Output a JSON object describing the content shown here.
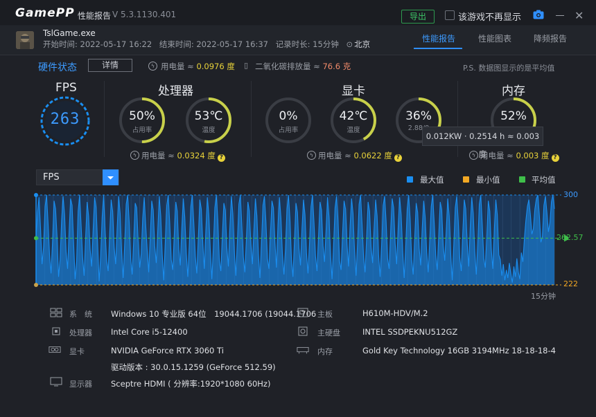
{
  "window": {
    "brand": "GamePP",
    "title": "性能报告",
    "version": "V 5.3.1130.401",
    "export_label": "导出",
    "no_show_label": "该游戏不再显示"
  },
  "session": {
    "process": "TslGame.exe",
    "start": "开始时间: 2022-05-17 16:22",
    "end": "结束时间: 2022-05-17 16:37",
    "duration": "记录时长: 15分钟",
    "location": "北京"
  },
  "tabs": [
    "性能报告",
    "性能图表",
    "降频报告"
  ],
  "hardware": {
    "title": "硬件状态",
    "detail_label": "详情",
    "power_label": "用电量 ≈",
    "power_value": "0.0976 度",
    "co2_label": "二氧化碳排放量 ≈",
    "co2_value": "76.6 克",
    "note": "P.S. 数据图显示的是平均值"
  },
  "fps": {
    "title": "FPS",
    "value": "263"
  },
  "cpu": {
    "title": "处理器",
    "usage": "50%",
    "usage_label": "占用率",
    "usage_frac": 0.5,
    "temp": "53℃",
    "temp_label": "温度",
    "temp_frac": 0.53,
    "power_label": "用电量 ≈",
    "power_value": "0.0324 度"
  },
  "gpu": {
    "title": "显卡",
    "usage": "0%",
    "usage_label": "占用率",
    "usage_frac": 0.0,
    "temp": "42℃",
    "temp_label": "温度",
    "temp_frac": 0.42,
    "vram": "36%",
    "vram_sub": "2.88/8",
    "vram_frac": 0.36,
    "power_label": "用电量 ≈",
    "power_value": "0.0622 度"
  },
  "mem": {
    "title": "内存",
    "usage": "52%",
    "usage_frac": 0.52,
    "power_label": "用电量 ≈",
    "power_value": "0.003 度"
  },
  "tooltip": "0.012KW · 0.2514 h ≈ 0.003度",
  "chart_select": "FPS",
  "legend": {
    "max": "最大值",
    "min": "最小值",
    "avg": "平均值"
  },
  "colors": {
    "accent": "#2f8fff",
    "max": "#1a8ef0",
    "min": "#f2a824",
    "avg": "#3fbf4a",
    "yellow": "#e8d23a"
  },
  "chart_data": {
    "type": "area",
    "series": [
      {
        "name": "FPS"
      }
    ],
    "y_ticks": [
      "300",
      "262.57",
      "222"
    ],
    "ylim": [
      222,
      300
    ],
    "avg": 262.57,
    "x_label": "15分钟",
    "values": [
      262,
      285,
      298,
      271,
      240,
      255,
      290,
      300,
      276,
      248,
      232,
      260,
      295,
      288,
      264,
      229,
      244,
      278,
      299,
      283,
      251,
      236,
      268,
      297,
      291,
      259,
      227,
      242,
      286,
      300,
      274,
      246,
      230,
      263,
      294,
      282,
      253,
      238,
      270,
      298,
      289,
      257,
      225,
      247,
      281,
      300,
      269,
      243,
      234,
      266,
      296,
      286,
      255,
      240,
      272,
      299,
      284,
      250,
      228,
      258,
      292,
      300,
      277,
      245,
      231,
      261,
      293,
      289,
      260,
      237,
      249,
      280,
      298,
      274,
      252,
      233,
      264,
      295,
      287,
      256,
      241,
      268,
      299,
      282,
      248,
      226,
      259,
      291,
      300,
      275,
      244,
      235,
      266,
      294,
      286,
      253,
      239,
      271,
      297,
      281,
      250,
      229,
      257,
      290,
      300,
      276,
      247,
      232,
      263,
      296,
      288,
      258,
      236,
      269,
      298,
      283,
      252,
      227,
      254,
      289,
      300,
      278,
      243,
      234,
      265,
      293,
      287,
      255,
      238,
      272,
      299,
      284,
      251,
      230,
      260,
      292,
      300,
      273,
      246,
      233,
      262,
      294,
      286,
      257,
      240,
      270,
      297,
      282,
      249,
      228,
      256,
      291,
      299,
      277,
      245,
      236,
      267,
      295,
      289,
      259,
      237,
      274,
      298,
      280,
      248,
      231,
      253,
      288,
      300,
      279,
      244,
      229,
      261,
      293,
      285,
      254,
      239,
      271,
      296,
      283,
      250,
      232,
      258,
      290,
      300,
      276,
      247,
      234,
      264,
      294,
      287,
      256,
      242,
      269,
      298,
      281,
      249,
      227,
      255,
      289,
      299,
      278,
      243,
      235,
      266,
      295,
      288,
      257,
      238,
      273,
      297,
      284,
      251,
      230,
      259,
      292,
      300,
      275,
      246,
      233,
      263,
      294,
      286,
      255,
      241,
      270,
      296,
      282,
      248,
      229,
      257,
      291,
      299,
      277,
      245,
      236,
      268,
      297,
      289,
      258,
      240,
      272,
      298,
      283,
      252,
      228,
      254,
      288,
      300,
      279,
      244,
      231,
      262,
      293,
      285,
      254,
      239,
      271,
      295,
      281,
      250,
      233,
      260,
      290,
      300,
      276,
      248,
      235,
      265,
      294,
      287,
      256,
      243,
      269,
      297,
      282,
      249,
      226,
      256,
      289,
      299,
      278,
      246,
      234,
      267,
      296,
      288,
      257,
      238,
      274,
      298,
      284,
      251,
      231,
      258,
      292,
      300,
      274,
      245,
      237,
      264,
      295,
      286,
      253,
      236,
      270,
      296,
      283,
      248,
      244,
      230,
      240,
      226,
      235,
      228,
      241,
      232,
      224,
      238,
      229,
      245,
      233,
      227,
      250,
      242,
      262,
      278,
      290,
      296,
      283,
      266,
      271,
      288,
      297,
      300,
      282,
      259,
      264,
      291,
      299,
      285,
      268,
      276,
      294,
      300,
      288
    ],
    "annotations": []
  },
  "specs": {
    "sys_label": "系　统",
    "sys_value": "Windows 10 专业版 64位　19044.1706 (19044.1706",
    "cpu_label": "处理器",
    "cpu_value": "Intel Core i5-12400",
    "gpu_label": "显卡",
    "gpu_value": "NVIDIA GeForce RTX 3060 Ti",
    "driver_value": "驱动版本 : 30.0.15.1259 (GeForce 512.59)",
    "display_label": "显示器",
    "display_value": "Sceptre HDMI ( 分辨率:1920*1080 60Hz)",
    "board_label": "主板",
    "board_value": "H610M-HDV/M.2",
    "disk_label": "主硬盘",
    "disk_value": "INTEL SSDPEKNU512GZ",
    "ram_label": "内存",
    "ram_value": "Gold Key Technology 16GB 3194MHz 18-18-18-4"
  }
}
